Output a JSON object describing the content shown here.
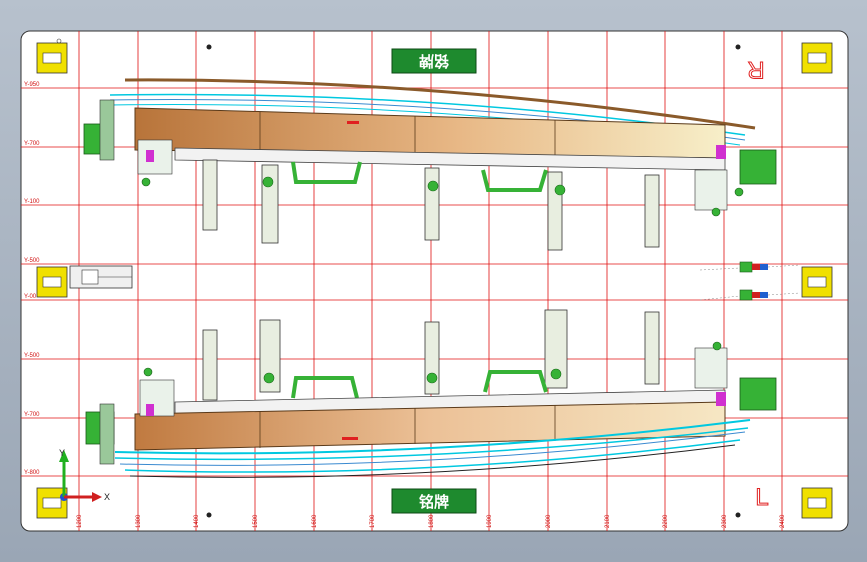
{
  "drawing": {
    "nameplate_top": "铭牌",
    "nameplate_bottom": "铭牌",
    "mark_right": "R",
    "mark_left": "L",
    "axis_x": "X",
    "axis_y": "Y",
    "y_labels": [
      "Y-950",
      "Y-700",
      "Y-100",
      "Y-500",
      "Y-00",
      "Y-500",
      "Y-700",
      "Y-800"
    ],
    "x_labels": [
      "1200",
      "1300",
      "1400",
      "1500",
      "1600",
      "1700",
      "1800",
      "1900",
      "2000",
      "2100",
      "2200",
      "2300",
      "2400"
    ]
  },
  "colors": {
    "background_top": "#b7c1cd",
    "sheet": "#ffffff",
    "grid": "#e01010",
    "nameplate": "#1e8a2e",
    "pin_pad": "#f0e000",
    "rail": "#c8895a",
    "rail_light": "#f2dcc0",
    "cyan_line": "#00c8e0",
    "clamp_green": "#36b236",
    "magenta": "#d030d0"
  }
}
